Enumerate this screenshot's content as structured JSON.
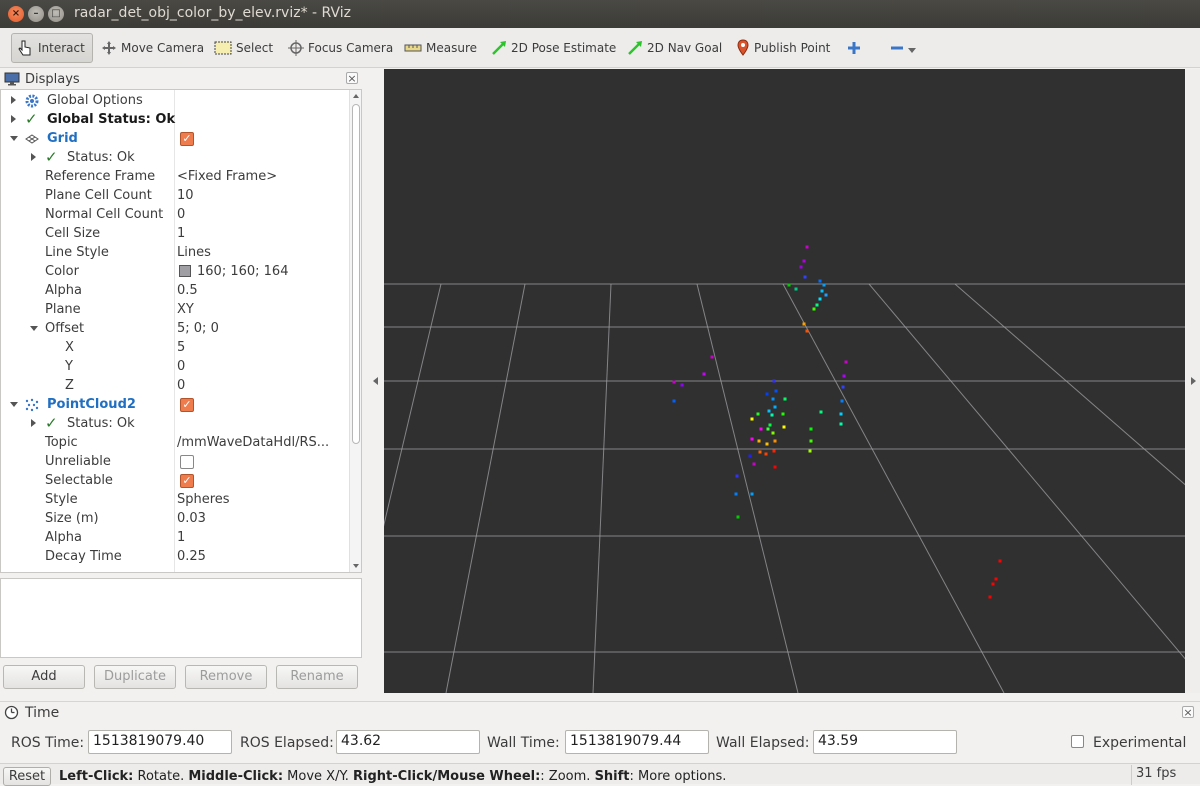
{
  "window": {
    "title": "radar_det_obj_color_by_elev.rviz* - RViz"
  },
  "toolbar": {
    "interact": "Interact",
    "move_camera": "Move Camera",
    "select": "Select",
    "focus_camera": "Focus Camera",
    "measure": "Measure",
    "pose_estimate": "2D Pose Estimate",
    "nav_goal": "2D Nav Goal",
    "publish_point": "Publish Point"
  },
  "displays": {
    "title": "Displays",
    "rows": {
      "global_options": "Global Options",
      "global_status": "Global Status: Ok",
      "grid": "Grid",
      "grid_status": "Status: Ok",
      "reference_frame_label": "Reference Frame",
      "reference_frame_value": "<Fixed Frame>",
      "plane_cell_count_label": "Plane Cell Count",
      "plane_cell_count_value": "10",
      "normal_cell_count_label": "Normal Cell Count",
      "normal_cell_count_value": "0",
      "cell_size_label": "Cell Size",
      "cell_size_value": "1",
      "line_style_label": "Line Style",
      "line_style_value": "Lines",
      "color_label": "Color",
      "color_value": "160; 160; 164",
      "alpha_label": "Alpha",
      "alpha_value": "0.5",
      "plane_label": "Plane",
      "plane_value": "XY",
      "offset_label": "Offset",
      "offset_value": "5; 0; 0",
      "x_label": "X",
      "x_value": "5",
      "y_label": "Y",
      "y_value": "0",
      "z_label": "Z",
      "z_value": "0",
      "pointcloud": "PointCloud2",
      "pc_status": "Status: Ok",
      "topic_label": "Topic",
      "topic_value": "/mmWaveDataHdl/RS...",
      "unreliable_label": "Unreliable",
      "selectable_label": "Selectable",
      "style_label": "Style",
      "style_value": "Spheres",
      "size_label": "Size (m)",
      "size_value": "0.03",
      "pc_alpha_label": "Alpha",
      "pc_alpha_value": "1",
      "decay_label": "Decay Time",
      "decay_value": "0.25"
    },
    "grid_color": "#a0a0a4",
    "buttons": {
      "add": "Add",
      "duplicate": "Duplicate",
      "remove": "Remove",
      "rename": "Rename"
    }
  },
  "time": {
    "title": "Time",
    "ros_time_label": "ROS Time:",
    "ros_time_value": "1513819079.40",
    "ros_elapsed_label": "ROS Elapsed:",
    "ros_elapsed_value": "43.62",
    "wall_time_label": "Wall Time:",
    "wall_time_value": "1513819079.44",
    "wall_elapsed_label": "Wall Elapsed:",
    "wall_elapsed_value": "43.59",
    "experimental_label": "Experimental"
  },
  "status": {
    "reset": "Reset",
    "hint_left_click": "Left-Click:",
    "hint_rotate": " Rotate. ",
    "hint_middle_click": "Middle-Click:",
    "hint_move": " Move X/Y. ",
    "hint_right_click": "Right-Click/Mouse Wheel:",
    "hint_zoom": ": Zoom. ",
    "hint_shift": "Shift",
    "hint_more": ": More options.",
    "fps": "31 fps"
  },
  "colors": {
    "viewport_bg": "#303030",
    "grid_line": "#a0a0a4",
    "checkbox_on": "#ee7c4c",
    "link_blue": "#1f6fc2"
  }
}
